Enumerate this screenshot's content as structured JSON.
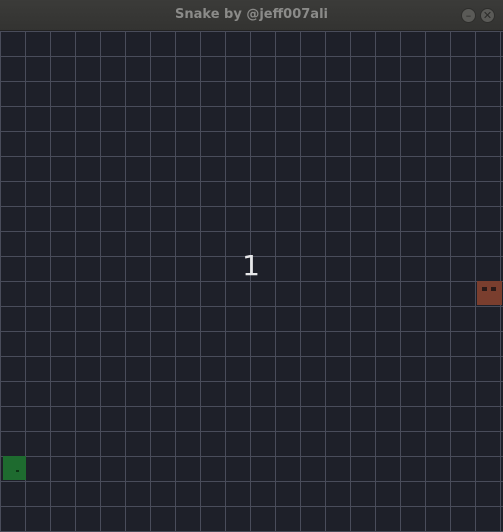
{
  "window": {
    "title": "Snake by @jeff007ali",
    "minimize_glyph": "–",
    "close_glyph": "✕"
  },
  "game": {
    "score": "1",
    "grid_lines_color": "#494c5a",
    "background_color": "#1e2029",
    "snake_color": "#1e6b2f",
    "food_color": "#7a3e2e"
  }
}
